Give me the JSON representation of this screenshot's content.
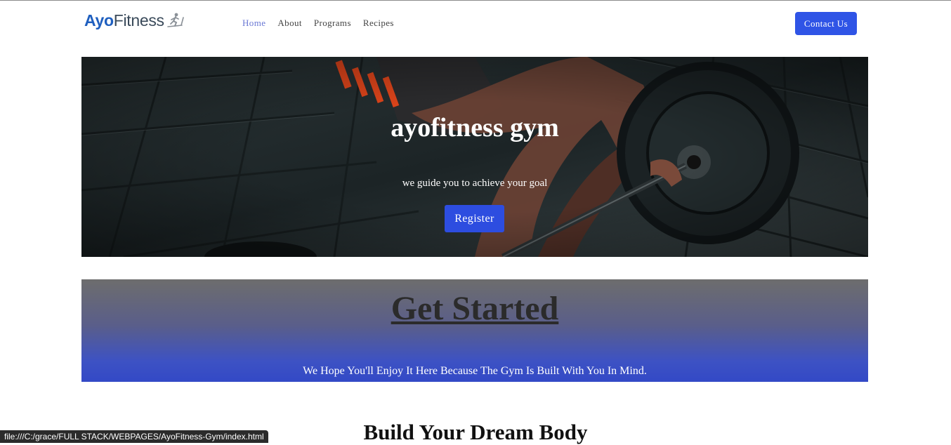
{
  "logo": {
    "part1": "Ayo",
    "part2": "Fitness",
    "icon": "treadmill-runner-icon"
  },
  "nav": {
    "links": [
      "Home",
      "About",
      "Programs",
      "Recipes"
    ],
    "contact_label": "Contact Us"
  },
  "hero": {
    "title": "ayofitness gym",
    "subtitle": "we guide you to achieve your goal",
    "register_label": "Register"
  },
  "get_started": {
    "title": "Get Started",
    "subtitle": "We Hope You'll Enjoy It Here Because The Gym Is Built With You In Mind."
  },
  "section_heading": "Build Your Dream Body",
  "status_url": "file:///C:/grace/FULL STACK/WEBPAGES/AyoFitness-Gym/index.html",
  "colors": {
    "accent": "#2f54e6",
    "logo_blue": "#1f5fbf",
    "active_link": "#6a78d4"
  }
}
